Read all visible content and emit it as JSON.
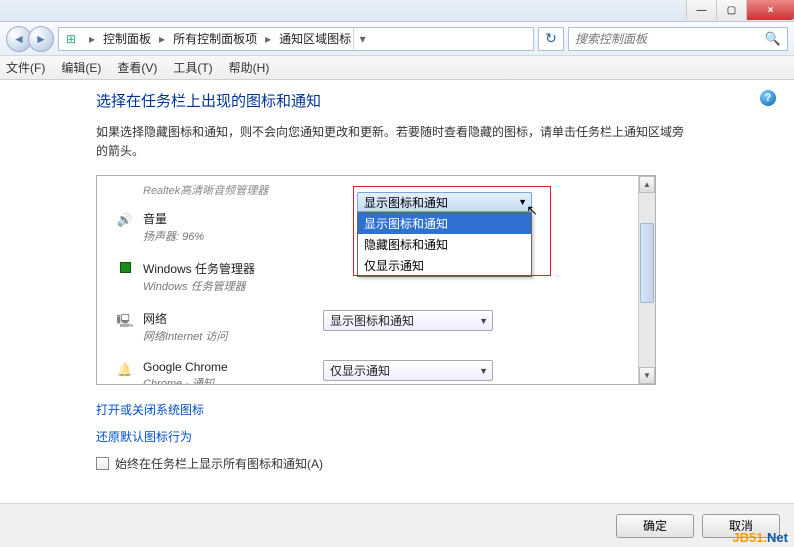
{
  "titlebar": {
    "blur_text": ""
  },
  "window": {
    "min": "—",
    "max": "▢",
    "close": "×"
  },
  "breadcrumb": {
    "items": [
      "控制面板",
      "所有控制面板项",
      "通知区域图标"
    ]
  },
  "search": {
    "placeholder": "搜索控制面板"
  },
  "menu": {
    "file": "文件(F)",
    "edit": "编辑(E)",
    "view": "查看(V)",
    "tools": "工具(T)",
    "help": "帮助(H)"
  },
  "page": {
    "title": "选择在任务栏上出现的图标和通知",
    "desc": "如果选择隐藏图标和通知，则不会向您通知更改和更新。若要随时查看隐藏的图标，请单击任务栏上通知区域旁的箭头。"
  },
  "truncated_row": "Realtek高清晰音频管理器",
  "rows": [
    {
      "title": "音量",
      "sub": "扬声器: 96%",
      "icon": "speaker",
      "combo": null
    },
    {
      "title": "Windows 任务管理器",
      "sub": "Windows 任务管理器",
      "icon": "task",
      "combo": null
    },
    {
      "title": "网络",
      "sub": "网络Internet 访问",
      "icon": "net",
      "combo": "显示图标和通知"
    },
    {
      "title": "Google Chrome",
      "sub": "Chrome - 通知",
      "icon": "bell",
      "combo": "仅显示通知"
    }
  ],
  "dropdown": {
    "selected": "显示图标和通知",
    "options": [
      "显示图标和通知",
      "隐藏图标和通知",
      "仅显示通知"
    ],
    "highlighted_index": 0
  },
  "links": {
    "link1": "打开或关闭系统图标",
    "link2": "还原默认图标行为"
  },
  "checkbox": {
    "label": "始终在任务栏上显示所有图标和通知(A)"
  },
  "buttons": {
    "ok": "确定",
    "cancel": "取消"
  },
  "watermark": {
    "a": "JB51.",
    "b": "Net"
  }
}
